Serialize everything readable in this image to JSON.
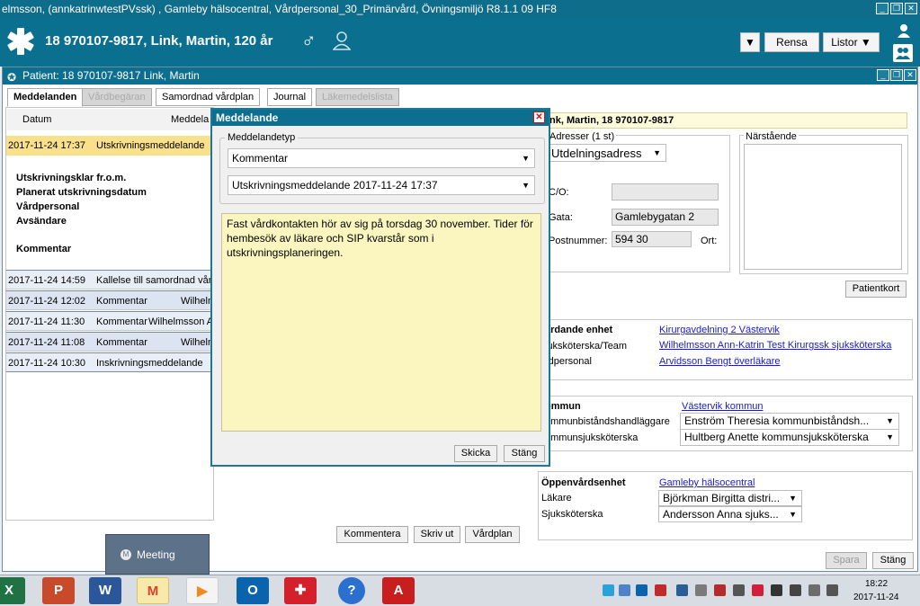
{
  "window_title": "elmsson, (annkatrinwtestPVssk) , Gamleby hälsocentral, Vårdpersonal_30_Primärvård, Övningsmiljö R8.1.1 09 HF8",
  "header": {
    "patient": "18 970107-9817,  Link, Martin,  120 år",
    "rensa": "Rensa",
    "listor": "Listor ▼"
  },
  "panel_title": "Patient: 18 970107-9817 Link, Martin",
  "tabs": [
    "Meddelanden",
    "Vårdbegäran",
    "Samordnad vårdplan",
    "Journal",
    "Läkemedelslista"
  ],
  "list": {
    "col_date": "Datum",
    "col_msg": "Meddela",
    "selected": {
      "date": "2017-11-24 17:37",
      "type": "Utskrivningsmeddelande"
    },
    "details": [
      "Utskrivningsklar fr.o.m.",
      "Planerat utskrivningsdatum",
      "Vårdpersonal",
      "Avsändare",
      "Kommentar"
    ],
    "rows": [
      {
        "date": "2017-11-24 14:59",
        "type": "Kallelse till samordnad vård",
        "sender": ""
      },
      {
        "date": "2017-11-24 12:02",
        "type": "Kommentar",
        "sender": "Wilhelm"
      },
      {
        "date": "2017-11-24 11:30",
        "type": "Kommentar",
        "sender": "Wilhelmsson A"
      },
      {
        "date": "2017-11-24 11:08",
        "type": "Kommentar",
        "sender": "Wilhelm"
      },
      {
        "date": "2017-11-24 10:30",
        "type": "Inskrivningsmeddelande",
        "sender": ""
      }
    ]
  },
  "buttons": {
    "kommentera": "Kommentera",
    "skriv_ut": "Skriv ut",
    "vardplan": "Vårdplan",
    "spara": "Spara",
    "stang": "Stäng",
    "patientkort": "Patientkort"
  },
  "dialog": {
    "title": "Meddelande",
    "group": "Meddelandetyp",
    "type": "Kommentar",
    "message": "Utskrivningsmeddelande 2017-11-24 17:37",
    "text": "Fast vårdkontakten hör av sig på torsdag 30 november. Tider för hembesök av läkare och SIP kvarstår som i utskrivningsplaneringen.",
    "skicka": "Skicka",
    "stang": "Stäng"
  },
  "right": {
    "patient_bar": "nk, Martin, 18 970107-9817",
    "adresser": "Adresser (1 st)",
    "address_type": "Utdelningsadress",
    "co": "C/O:",
    "gata": "Gata:",
    "gata_value": "Gamlebygatan 2",
    "postnummer": "Postnummer:",
    "postnummer_value": "594 30",
    "ort": "Ort:",
    "narstaende": "Närstående",
    "vardande_enhet": "ardande enhet",
    "vardande_value": "Kirurgavdelning 2 Västervik",
    "ssk_team": "juksköterska/Team",
    "ssk_team_value": "Wilhelmsson Ann-Katrin Test Kirurgssk sjuksköterska",
    "vardpersonal": "rdpersonal",
    "vardpersonal_value": "Arvidsson Bengt överläkare",
    "kommun": "ommun",
    "kommun_value": "Västervik kommun",
    "kbh": "ommunbiståndshandläggare",
    "kbh_value": "Enström Theresia kommunbiståndsh...",
    "ksk": "ommunsjuksköterska",
    "ksk_value": "Hultberg Anette kommunsjuksköterska",
    "oppen": "Öppenvårdsenhet",
    "oppen_value": "Gamleby hälsocentral",
    "lakare": "Läkare",
    "lakare_value": "Björkman Birgitta distri...",
    "sjukskoterska": "Sjuksköterska",
    "sjukskoterska_value": "Andersson Anna sjuks..."
  },
  "meeting_popup": "Meeting",
  "clock": {
    "time": "18:22",
    "date": "2017-11-24"
  }
}
